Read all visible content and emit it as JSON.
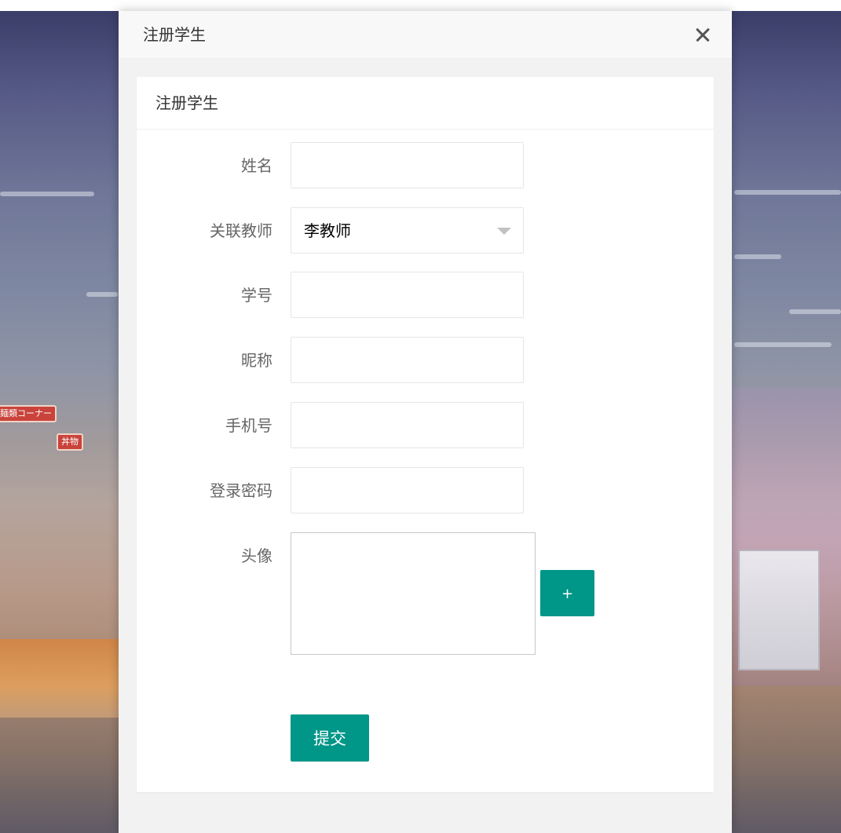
{
  "background": {
    "signs": [
      "麺類コーナー",
      "丼物"
    ]
  },
  "dialog": {
    "title": "注册学生",
    "close_icon": "close-icon"
  },
  "form": {
    "card_title": "注册学生",
    "fields": [
      {
        "label": "姓名",
        "value": "",
        "type": "text"
      },
      {
        "label": "关联教师",
        "value": "李教师",
        "type": "select"
      },
      {
        "label": "学号",
        "value": "",
        "type": "text"
      },
      {
        "label": "昵称",
        "value": "",
        "type": "text"
      },
      {
        "label": "手机号",
        "value": "",
        "type": "text"
      },
      {
        "label": "登录密码",
        "value": "",
        "type": "password"
      }
    ],
    "avatar": {
      "label": "头像",
      "upload_label": "+"
    },
    "submit_label": "提交"
  },
  "colors": {
    "primary": "#009688",
    "label": "#666666",
    "border": "#e6e6e6",
    "modal_bg": "#f2f2f2"
  }
}
